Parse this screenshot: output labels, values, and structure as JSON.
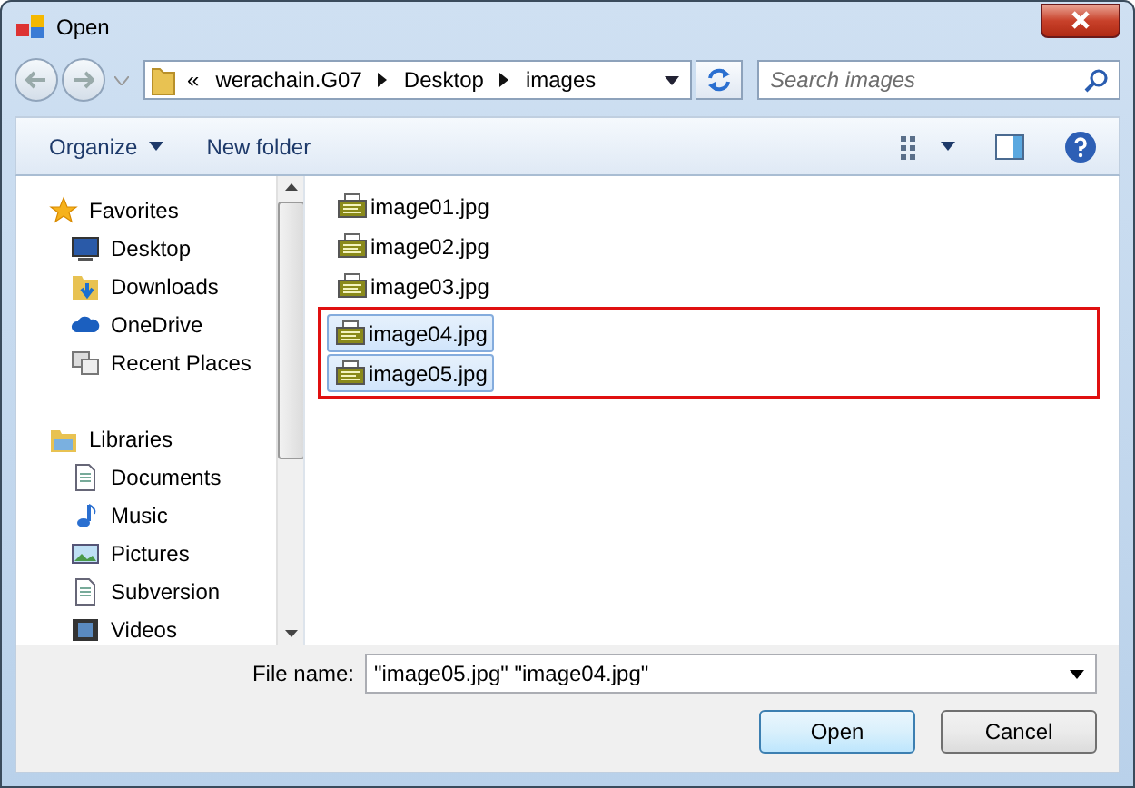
{
  "window": {
    "title": "Open"
  },
  "address": {
    "overflow": "«",
    "crumbs": [
      "werachain.G07",
      "Desktop",
      "images"
    ]
  },
  "search": {
    "placeholder": "Search images"
  },
  "toolbar": {
    "organize": "Organize",
    "new_folder": "New folder"
  },
  "sidebar": {
    "groups": [
      {
        "label": "Favorites",
        "children": [
          {
            "label": "Desktop"
          },
          {
            "label": "Downloads"
          },
          {
            "label": "OneDrive"
          },
          {
            "label": "Recent Places"
          }
        ]
      },
      {
        "label": "Libraries",
        "children": [
          {
            "label": "Documents"
          },
          {
            "label": "Music"
          },
          {
            "label": "Pictures"
          },
          {
            "label": "Subversion"
          },
          {
            "label": "Videos"
          }
        ]
      }
    ]
  },
  "files": [
    {
      "name": "image01.jpg",
      "selected": false,
      "highlighted": false
    },
    {
      "name": "image02.jpg",
      "selected": false,
      "highlighted": false
    },
    {
      "name": "image03.jpg",
      "selected": false,
      "highlighted": false
    },
    {
      "name": "image04.jpg",
      "selected": true,
      "highlighted": true
    },
    {
      "name": "image05.jpg",
      "selected": true,
      "highlighted": true
    }
  ],
  "file_name": {
    "label": "File name:",
    "value": "\"image05.jpg\" \"image04.jpg\""
  },
  "buttons": [
    {
      "label": "Open",
      "default": true
    },
    {
      "label": "Cancel",
      "default": false
    }
  ]
}
